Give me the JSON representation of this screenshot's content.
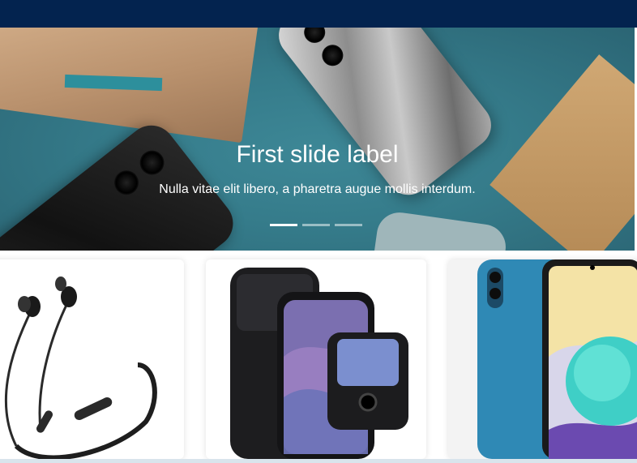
{
  "carousel": {
    "active_index": 0,
    "slides_count": 3,
    "slide": {
      "title": "First slide label",
      "text": "Nulla vitae elit libero, a pharetra augue mollis interdum."
    }
  },
  "products": [
    {
      "image": "earphones-neckband-image"
    },
    {
      "image": "flip-phone-image"
    },
    {
      "image": "blue-smartphone-image"
    }
  ],
  "colors": {
    "navbar": "#03234f",
    "carousel_bg": "#357b8a",
    "footer_strip": "#d9e4ec"
  }
}
